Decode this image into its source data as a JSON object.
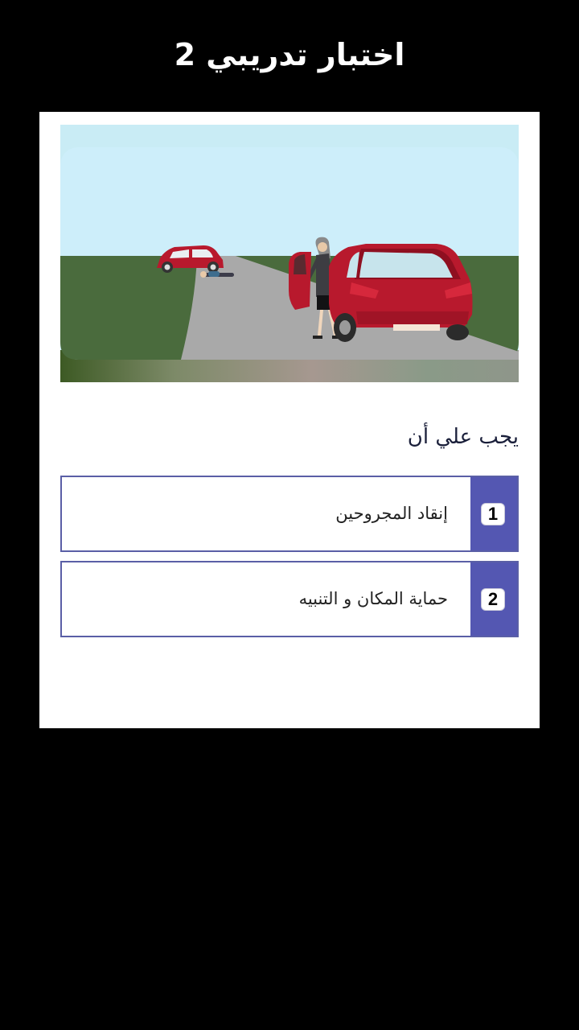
{
  "header": {
    "title": "اختبار تدريبي 2"
  },
  "question": {
    "image_icon": "accident-scene-illustration",
    "text": "يجب علي أن"
  },
  "options": [
    {
      "number": "1",
      "text": "إنقاد المجروحين"
    },
    {
      "number": "2",
      "text": "حماية المكان و التنبيه"
    }
  ],
  "colors": {
    "background": "#000000",
    "card": "#ffffff",
    "accent": "#5457b2",
    "option_border": "#5a5fa6",
    "car": "#b8192d",
    "sky": "#cdeefa",
    "grass": "#4a6b3d",
    "road": "#a9a9a9"
  }
}
